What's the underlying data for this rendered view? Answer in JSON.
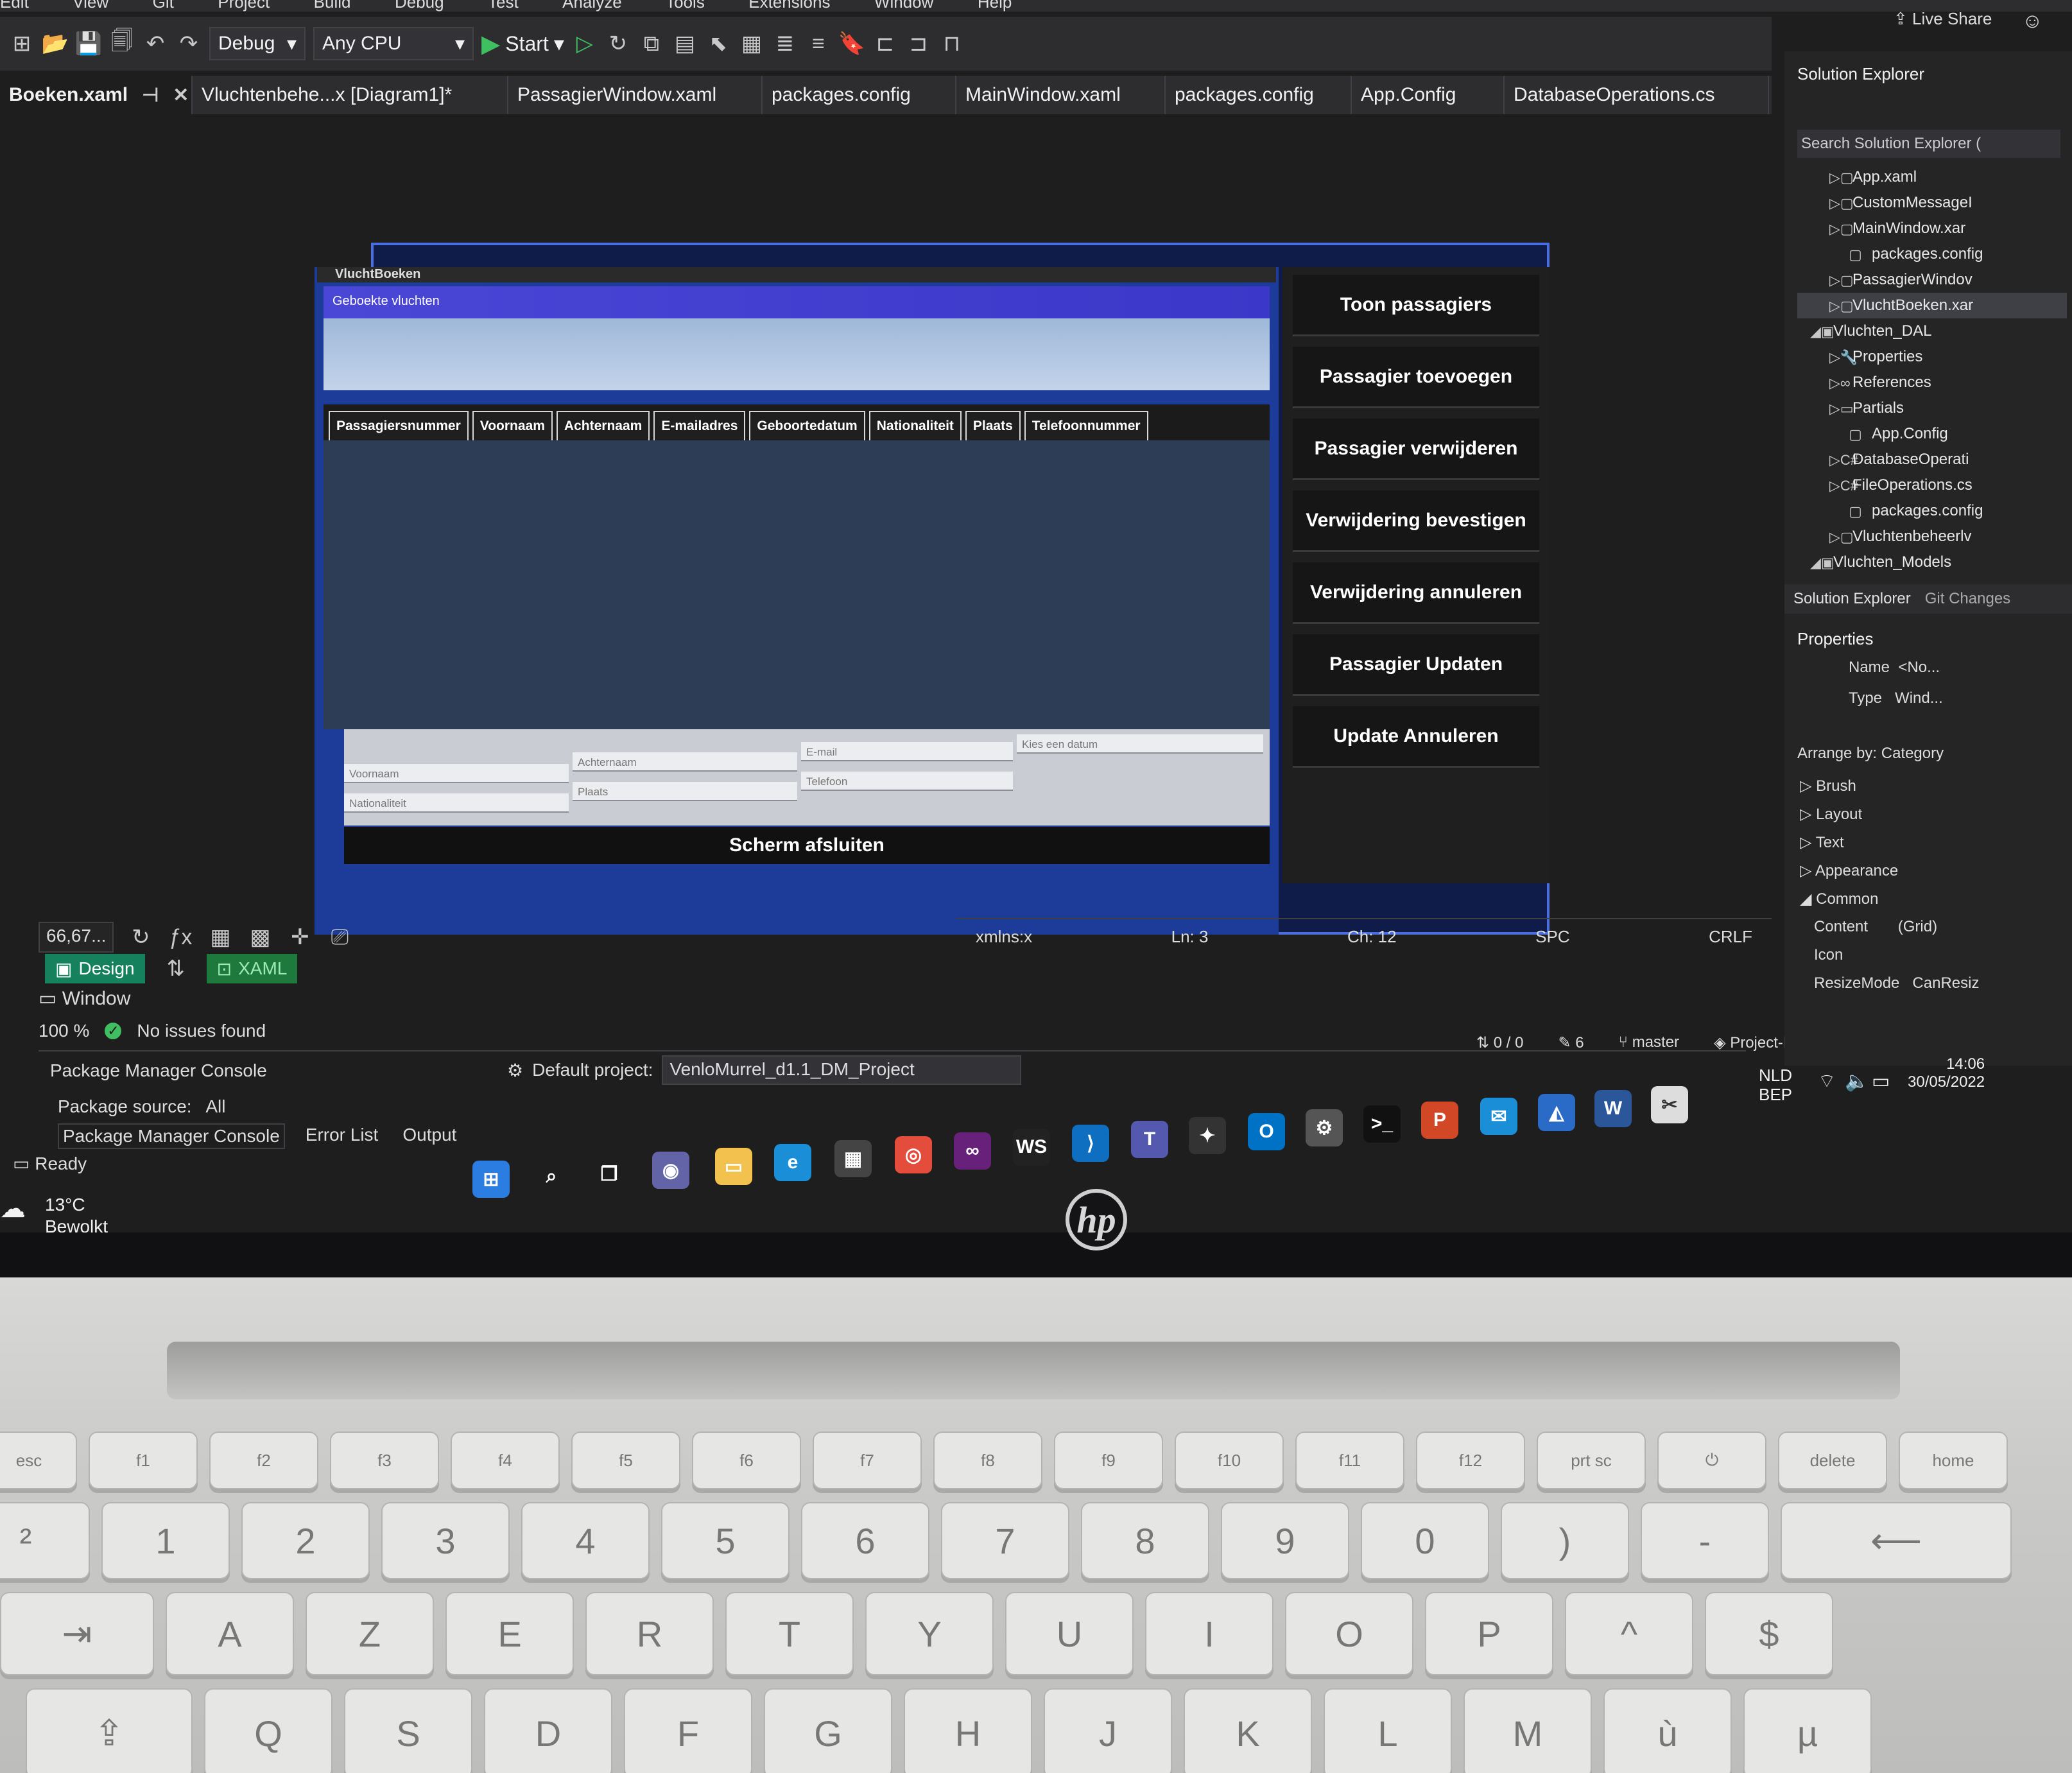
{
  "menu": [
    "Edit",
    "View",
    "Git",
    "Project",
    "Build",
    "Debug",
    "Test",
    "Analyze",
    "Tools",
    "Extensions",
    "Window",
    "Help"
  ],
  "toolbar": {
    "config": "Debug",
    "platform": "Any CPU",
    "start_label": "Start",
    "live_share": "Live Share"
  },
  "tabs": [
    {
      "label": "Boeken.xaml"
    },
    {
      "label": "Vluchtenbehe...x [Diagram1]*"
    },
    {
      "label": "PassagierWindow.xaml"
    },
    {
      "label": "packages.config"
    },
    {
      "label": "MainWindow.xaml"
    },
    {
      "label": "packages.config"
    },
    {
      "label": "App.Config"
    },
    {
      "label": "DatabaseOperations.cs"
    }
  ],
  "app": {
    "window_title": "VluchtBoeken",
    "banner": "Geboekte vluchten",
    "columns": [
      "Passagiersnummer",
      "Voornaam",
      "Achternaam",
      "E-mailadres",
      "Geboortedatum",
      "Nationaliteit",
      "Plaats",
      "Telefoonnummer"
    ],
    "fields": {
      "voornaam": "Voornaam",
      "achternaam": "Achternaam",
      "email": "E-mail",
      "datum": "Kies een datum",
      "nationaliteit": "Nationaliteit",
      "plaats": "Plaats",
      "telefoon": "Telefoon"
    },
    "close_button": "Scherm afsluiten",
    "side_buttons": [
      "Toon passagiers",
      "Passagier toevoegen",
      "Passagier verwijderen",
      "Verwijdering bevestigen",
      "Verwijdering annuleren",
      "Passagier Updaten",
      "Update Annuleren"
    ]
  },
  "designer": {
    "zoom": "66,67...",
    "design_tab": "Design",
    "xaml_tab": "XAML",
    "scope": "Window",
    "xmlns": "xmlns:x",
    "status_zoom": "100 %",
    "issues": "No issues found",
    "ln": "Ln: 3",
    "ch": "Ch: 12",
    "spc": "SPC",
    "crlf": "CRLF"
  },
  "pmc": {
    "title": "Package Manager Console",
    "source_label": "Package source:",
    "source_value": "All",
    "default_project_label": "Default project:",
    "default_project": "VenloMurrel_d1.1_DM_Project",
    "tabs": [
      "Package Manager Console",
      "Error List",
      "Output"
    ]
  },
  "git": {
    "changes": "0 / 0",
    "edits": "6",
    "branch": "master",
    "repo": "Project-Datamanipulatie"
  },
  "solution": {
    "title": "Solution Explorer",
    "search": "Search Solution Explorer (",
    "items": [
      {
        "label": "App.xaml"
      },
      {
        "label": "CustomMessageI"
      },
      {
        "label": "MainWindow.xar"
      },
      {
        "label": "packages.config"
      },
      {
        "label": "PassagierWindov"
      },
      {
        "label": "VluchtBoeken.xar"
      },
      {
        "label": "Vluchten_DAL"
      },
      {
        "label": "Properties"
      },
      {
        "label": "References"
      },
      {
        "label": "Partials"
      },
      {
        "label": "App.Config"
      },
      {
        "label": "DatabaseOperati"
      },
      {
        "label": "FileOperations.cs"
      },
      {
        "label": "packages.config"
      },
      {
        "label": "Vluchtenbeheerlv"
      },
      {
        "label": "Vluchten_Models"
      }
    ],
    "tabs": [
      "Solution Explorer",
      "Git Changes"
    ]
  },
  "properties": {
    "title": "Properties",
    "name_label": "Name",
    "name_value": "<No...",
    "type_label": "Type",
    "type_value": "Wind...",
    "arrange": "Arrange by: Category",
    "categories": [
      "Brush",
      "Layout",
      "Text",
      "Appearance",
      "Common"
    ],
    "common": [
      {
        "name": "Content",
        "value": "(Grid)"
      },
      {
        "name": "Icon",
        "value": ""
      },
      {
        "name": "ResizeMode",
        "value": "CanResiz"
      }
    ]
  },
  "status": {
    "ready": "Ready",
    "temp": "13°C",
    "weather": "Bewolkt",
    "lang": "NLD",
    "layout": "BEP",
    "time": "14:06",
    "date": "30/05/2022"
  },
  "brand": "hp"
}
